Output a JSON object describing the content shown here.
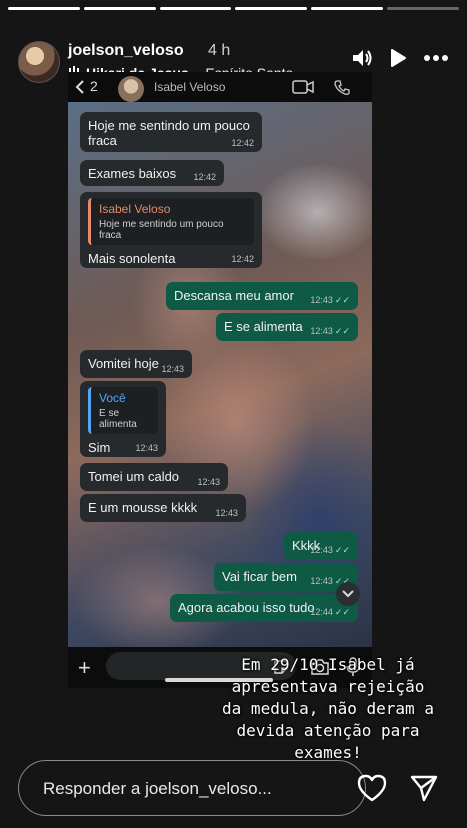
{
  "progress": {
    "total": 6,
    "current": 5
  },
  "header": {
    "username": "joelson_veloso",
    "posted_ago": "4 h",
    "music_song": "Hikari de Jesus",
    "music_separator": "·",
    "music_artist": "Espírito Santo"
  },
  "screenshot": {
    "back_count": "2",
    "contact_name": "Isabel Veloso",
    "messages": [
      {
        "dir": "in",
        "text": "Hoje me sentindo um pouco fraca",
        "time": "12:42"
      },
      {
        "dir": "in",
        "text": "Exames baixos",
        "time": "12:42"
      },
      {
        "dir": "in",
        "reply_to": "Isabel Veloso",
        "reply_text": "Hoje me sentindo um pouco fraca",
        "text": "Mais sonolenta",
        "time": "12:42"
      },
      {
        "dir": "out",
        "text": "Descansa meu amor",
        "time": "12:43"
      },
      {
        "dir": "out",
        "text": "E se alimenta",
        "time": "12:43"
      },
      {
        "dir": "in",
        "text": "Vomitei hoje",
        "time": "12:43"
      },
      {
        "dir": "in",
        "reply_to": "Você",
        "reply_text": "E se alimenta",
        "text": "Sim",
        "time": "12:43"
      },
      {
        "dir": "in",
        "text": "Tomei um caldo",
        "time": "12:43"
      },
      {
        "dir": "in",
        "text": "E um mousse kkkk",
        "time": "12:43"
      },
      {
        "dir": "out",
        "text": "Kkkk",
        "time": "12:43"
      },
      {
        "dir": "out",
        "text": "Vai ficar bem",
        "time": "12:43"
      },
      {
        "dir": "out",
        "text": "Agora acabou isso tudo",
        "time": "12:44"
      }
    ]
  },
  "caption": "Em 29/10 Isabel já apresentava rejeição da medula, não deram a devida atenção para exames!",
  "reply": {
    "placeholder": "Responder a joelson_veloso..."
  },
  "colors": {
    "incoming": "#262a2c",
    "outgoing": "#0e5a45",
    "reply_isabel": "#e58a6a",
    "reply_voce": "#53a6f0"
  },
  "icons": [
    "volume-icon",
    "play-icon",
    "more-icon",
    "music-note-icon",
    "back-arrow-icon",
    "video-call-icon",
    "phone-icon",
    "chevron-down-icon",
    "plus-icon",
    "sticker-icon",
    "camera-icon",
    "mic-icon",
    "heart-icon",
    "send-icon"
  ]
}
